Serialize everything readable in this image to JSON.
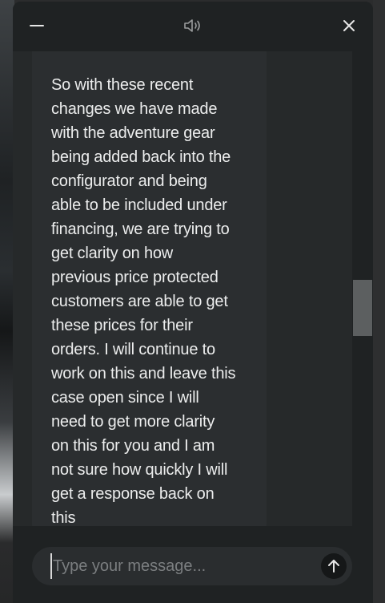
{
  "header": {
    "minimize_icon": "minus-icon",
    "sound_icon": "speaker-icon",
    "close_icon": "close-icon"
  },
  "messages": [
    {
      "sender": "agent",
      "lines": [
        "So with these recent",
        "changes we have made",
        "with the adventure gear",
        "being added back into the",
        "configurator and being",
        "able to be included under",
        "financing, we are trying to",
        "get clarity on how",
        "previous price protected",
        "customers are able to get",
        "these prices for their",
        "orders. I will continue to",
        "work on this and leave this",
        "case open since I will",
        "need to get more clarity",
        "on this for you and I am",
        "not sure how quickly I will",
        "get a response back on",
        "this"
      ]
    }
  ],
  "composer": {
    "placeholder": "Type your message...",
    "value": "",
    "send_icon": "arrow-up-icon"
  },
  "colors": {
    "window_bg": "#1f2223",
    "bubble_bg": "#2b2e30",
    "text": "#eceded",
    "placeholder": "#7b7e80"
  }
}
